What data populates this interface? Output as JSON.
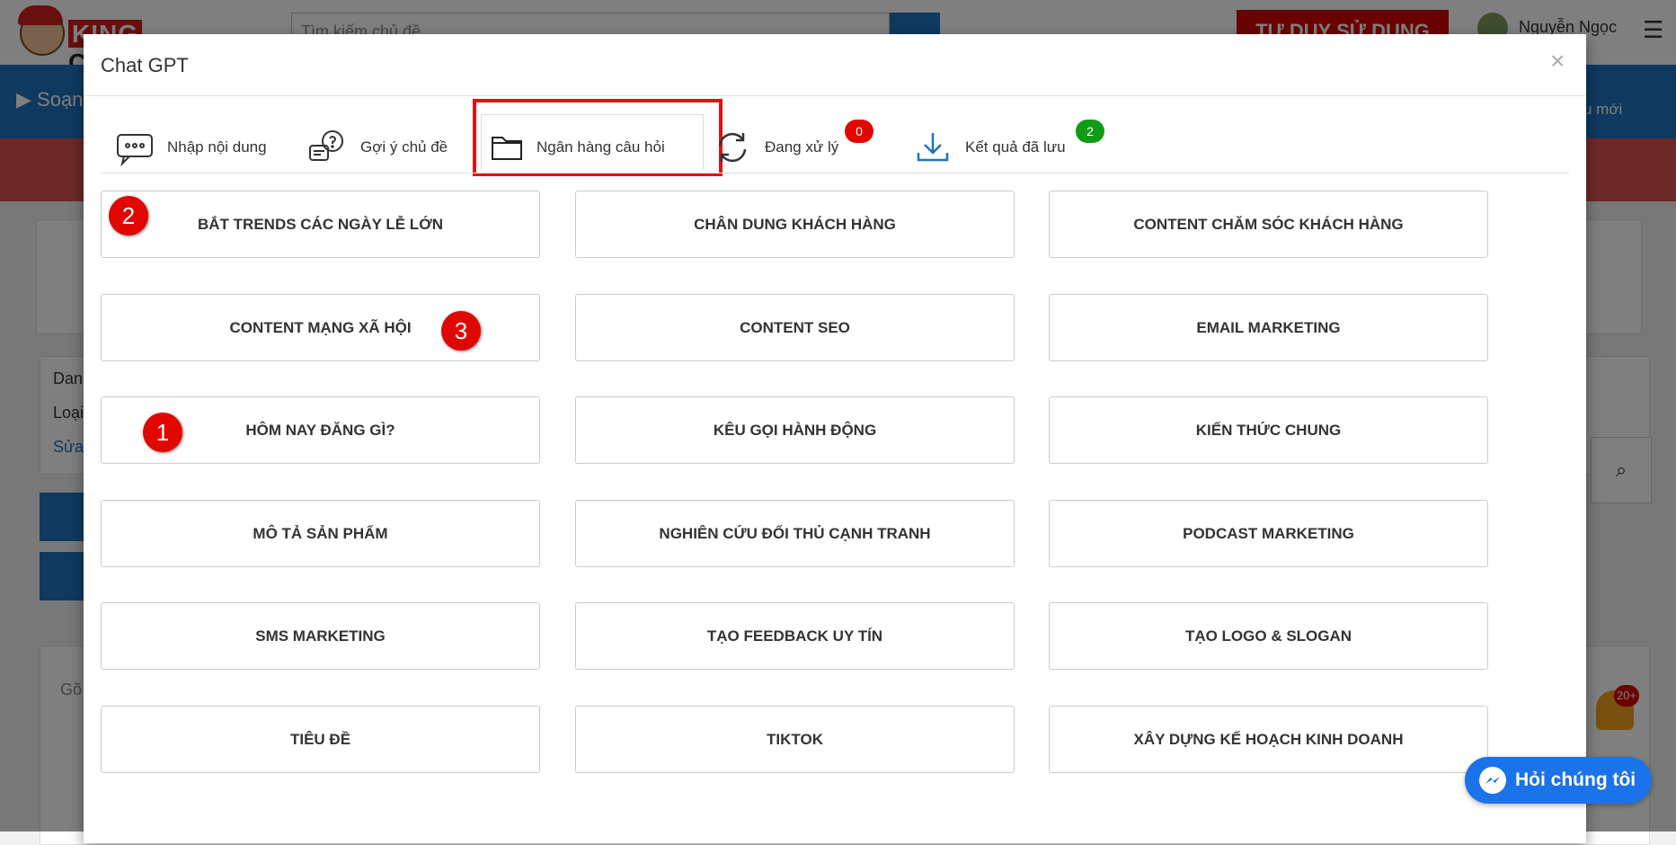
{
  "background": {
    "search_placeholder": "Tìm kiếm chủ đề",
    "cta_label": "TƯ DUY SỬ DỤNG",
    "user_name": "Nguyễn Ngọc",
    "nav_label": "Soạn",
    "nav_right_label": "u mới",
    "card_lines": [
      "Danh",
      "Loại",
      "Sửa"
    ],
    "card_input_hint": "Gõ",
    "bell_badge": "20+"
  },
  "modal": {
    "title": "Chat GPT",
    "close_label": "×",
    "tabs": [
      {
        "label": "Nhập nội dung",
        "icon": "chat-bubbles-icon"
      },
      {
        "label": "Gợi ý chủ đề",
        "icon": "question-bubble-icon"
      },
      {
        "label": "Ngân hàng câu hỏi",
        "icon": "folder-icon"
      },
      {
        "label": "Đang xử lý",
        "icon": "refresh-icon",
        "badge": "0"
      },
      {
        "label": "Kết quả đã lưu",
        "icon": "download-icon",
        "badge": "2"
      }
    ],
    "active_tab": "Ngân hàng câu hỏi",
    "categories": [
      "BẮT TRENDS CÁC NGÀY LỄ LỚN",
      "CHÂN DUNG KHÁCH HÀNG",
      "CONTENT CHĂM SÓC KHÁCH HÀNG",
      "CONTENT MẠNG XÃ HỘI",
      "CONTENT SEO",
      "EMAIL MARKETING",
      "HÔM NAY ĐĂNG GÌ?",
      "KÊU GỌI HÀNH ĐỘNG",
      "KIẾN THỨC CHUNG",
      "MÔ TẢ SẢN PHẨM",
      "NGHIÊN CỨU ĐỐI THỦ CẠNH TRANH",
      "PODCAST MARKETING",
      "SMS MARKETING",
      "TẠO FEEDBACK UY TÍN",
      "TẠO LOGO & SLOGAN",
      "TIÊU ĐỀ",
      "TIKTOK",
      "XÂY DỰNG KẾ HOẠCH KINH DOANH"
    ],
    "markers": [
      "2",
      "3",
      "1"
    ]
  },
  "messenger": {
    "label": "Hỏi chúng tôi"
  },
  "colors": {
    "brand_blue": "#1e73be",
    "accent_red": "#e11212",
    "progress_green": "#119a15",
    "badge_red": "#e10600",
    "badge_green": "#119a15"
  }
}
